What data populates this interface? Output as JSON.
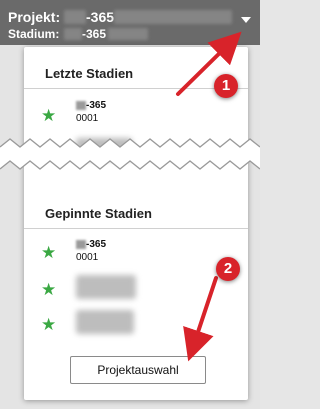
{
  "header": {
    "project_label": "Projekt:",
    "project_code": "-365",
    "stage_label": "Stadium:",
    "stage_code": "-365"
  },
  "recent": {
    "title": "Letzte Stadien",
    "items": [
      {
        "name": "-365",
        "number": "0001"
      }
    ]
  },
  "pinned": {
    "title": "Gepinnte Stadien",
    "items": [
      {
        "name": "-365",
        "number": "0001"
      }
    ]
  },
  "project_select_button": "Projektauswahl",
  "annotations": {
    "badge_1": "1",
    "badge_2": "2"
  },
  "icons": {
    "star": "star-icon",
    "caret": "caret-down-icon"
  },
  "colors": {
    "header_bg": "#6a6a6a",
    "star": "#3aa843",
    "badge": "#d8232a",
    "arrow": "#d8232a"
  }
}
